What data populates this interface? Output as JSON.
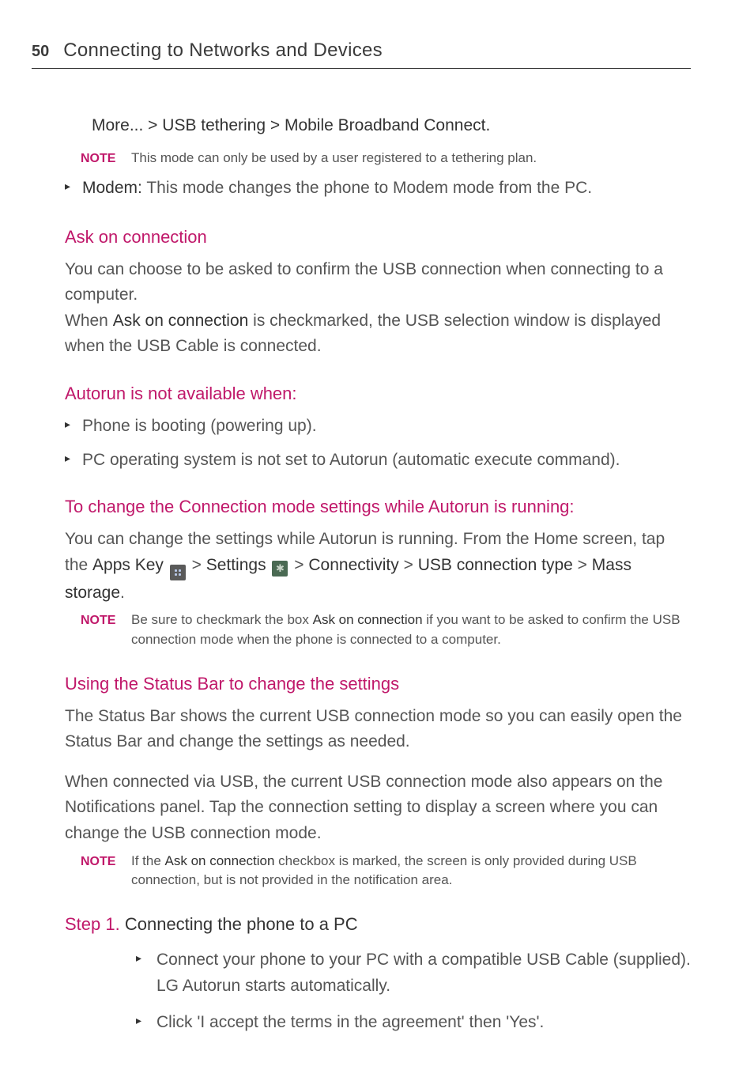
{
  "page_number": "50",
  "chapter_title": "Connecting to Networks and Devices",
  "breadcrumb": "More... > USB tethering > Mobile Broadband Connect.",
  "note1_label": "NOTE",
  "note1_text": "This mode can only be used by a user registered to a tethering plan.",
  "modem_bold": "Modem:",
  "modem_text": " This mode changes the phone to Modem mode from the PC.",
  "sec1_title": "Ask on connection",
  "sec1_p1": "You can choose to be asked to confirm the USB connection when connecting to a computer.",
  "sec1_p2a": "When ",
  "sec1_p2b": "Ask on connection",
  "sec1_p2c": " is checkmarked, the USB selection window is displayed when the USB Cable is connected.",
  "sec2_title": "Autorun is not available when:",
  "sec2_b1": "Phone is booting (powering up).",
  "sec2_b2": "PC operating system is not set to Autorun (automatic execute command).",
  "sec3_title": "To change the Connection mode settings while Autorun is running:",
  "sec3_p1a": "You can change the settings while Autorun is running. From the Home screen, tap the ",
  "sec3_apps": "Apps Key",
  "sec3_gt1": " > ",
  "sec3_settings": "Settings",
  "sec3_gt2": " > ",
  "sec3_conn": "Connectivity",
  "sec3_gt3": " > ",
  "sec3_usb": "USB connection type",
  "sec3_gt4": " > ",
  "sec3_mass": "Mass storage",
  "sec3_end": ".",
  "note2_label": "NOTE",
  "note2a": "Be sure to checkmark the box ",
  "note2b": "Ask on connection",
  "note2c": " if you want to be asked to confirm the USB connection mode when the phone is connected to a computer.",
  "sec4_title": "Using the Status Bar to change the settings",
  "sec4_p1": "The Status Bar shows the current USB connection mode so you can easily open the Status Bar and change the settings as needed.",
  "sec4_p2": "When connected via USB, the current USB connection mode also appears on the Notifications panel. Tap the connection setting to display a screen where you can change the USB connection mode.",
  "note3_label": "NOTE",
  "note3a": "If the ",
  "note3b": "Ask on connection",
  "note3c": " checkbox is marked, the screen is only provided during USB connection, but is not provided in the notification area.",
  "step1_label": "Step 1. ",
  "step1_title": "Connecting the phone to a PC",
  "step1_b1": "Connect your phone to your PC with a compatible USB Cable (supplied). LG Autorun starts automatically.",
  "step1_b2": "Click 'I accept the terms in the agreement' then 'Yes'."
}
